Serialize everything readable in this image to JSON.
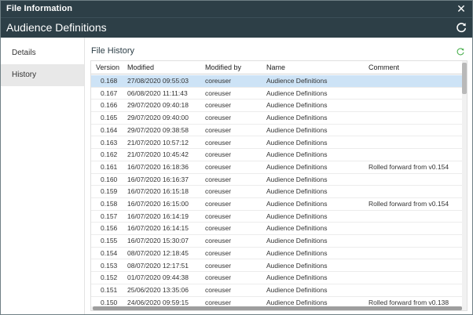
{
  "window": {
    "title": "File Information",
    "close_icon": "close-icon",
    "heading": "Audience Definitions",
    "refresh_icon": "refresh-icon"
  },
  "sidebar": {
    "items": [
      {
        "label": "Details",
        "active": false
      },
      {
        "label": "History",
        "active": true
      }
    ]
  },
  "main": {
    "section_title": "File History",
    "columns": [
      "Version",
      "Modified",
      "Modified by",
      "Name",
      "Comment"
    ],
    "rows": [
      {
        "version": "0.168",
        "modified": "27/08/2020 09:55:03",
        "by": "coreuser",
        "name": "Audience Definitions",
        "comment": ""
      },
      {
        "version": "0.167",
        "modified": "06/08/2020 11:11:43",
        "by": "coreuser",
        "name": "Audience Definitions",
        "comment": ""
      },
      {
        "version": "0.166",
        "modified": "29/07/2020 09:40:18",
        "by": "coreuser",
        "name": "Audience Definitions",
        "comment": ""
      },
      {
        "version": "0.165",
        "modified": "29/07/2020 09:40:00",
        "by": "coreuser",
        "name": "Audience Definitions",
        "comment": ""
      },
      {
        "version": "0.164",
        "modified": "29/07/2020 09:38:58",
        "by": "coreuser",
        "name": "Audience Definitions",
        "comment": ""
      },
      {
        "version": "0.163",
        "modified": "21/07/2020 10:57:12",
        "by": "coreuser",
        "name": "Audience Definitions",
        "comment": ""
      },
      {
        "version": "0.162",
        "modified": "21/07/2020 10:45:42",
        "by": "coreuser",
        "name": "Audience Definitions",
        "comment": ""
      },
      {
        "version": "0.161",
        "modified": "16/07/2020 16:18:36",
        "by": "coreuser",
        "name": "Audience Definitions",
        "comment": "Rolled forward from v0.154"
      },
      {
        "version": "0.160",
        "modified": "16/07/2020 16:16:37",
        "by": "coreuser",
        "name": "Audience Definitions",
        "comment": ""
      },
      {
        "version": "0.159",
        "modified": "16/07/2020 16:15:18",
        "by": "coreuser",
        "name": "Audience Definitions",
        "comment": ""
      },
      {
        "version": "0.158",
        "modified": "16/07/2020 16:15:00",
        "by": "coreuser",
        "name": "Audience Definitions",
        "comment": "Rolled forward from v0.154"
      },
      {
        "version": "0.157",
        "modified": "16/07/2020 16:14:19",
        "by": "coreuser",
        "name": "Audience Definitions",
        "comment": ""
      },
      {
        "version": "0.156",
        "modified": "16/07/2020 16:14:15",
        "by": "coreuser",
        "name": "Audience Definitions",
        "comment": ""
      },
      {
        "version": "0.155",
        "modified": "16/07/2020 15:30:07",
        "by": "coreuser",
        "name": "Audience Definitions",
        "comment": ""
      },
      {
        "version": "0.154",
        "modified": "08/07/2020 12:18:45",
        "by": "coreuser",
        "name": "Audience Definitions",
        "comment": ""
      },
      {
        "version": "0.153",
        "modified": "08/07/2020 12:17:51",
        "by": "coreuser",
        "name": "Audience Definitions",
        "comment": ""
      },
      {
        "version": "0.152",
        "modified": "01/07/2020 09:44:38",
        "by": "coreuser",
        "name": "Audience Definitions",
        "comment": ""
      },
      {
        "version": "0.151",
        "modified": "25/06/2020 13:35:06",
        "by": "coreuser",
        "name": "Audience Definitions",
        "comment": ""
      },
      {
        "version": "0.150",
        "modified": "24/06/2020 09:59:15",
        "by": "coreuser",
        "name": "Audience Definitions",
        "comment": "Rolled forward from v0.138"
      }
    ]
  },
  "colors": {
    "titlebar": "#2d3f47",
    "selected_row": "#cde3f6",
    "active_nav": "#e8e8e8",
    "refresh_accent": "#4cb050"
  }
}
